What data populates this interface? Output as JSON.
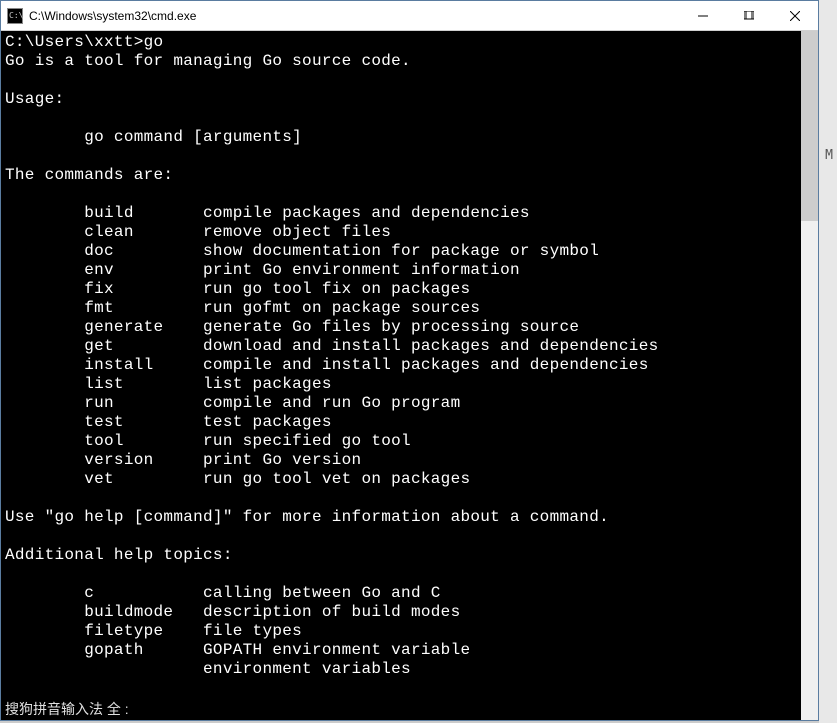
{
  "window": {
    "title": "C:\\Windows\\system32\\cmd.exe",
    "icon_text": "C:\\"
  },
  "prompt": {
    "path": "C:\\Users\\xxtt>",
    "command": "go"
  },
  "output": {
    "intro": "Go is a tool for managing Go source code.",
    "usage_label": "Usage:",
    "usage_line": "        go command [arguments]",
    "commands_header": "The commands are:",
    "commands": [
      {
        "name": "build",
        "desc": "compile packages and dependencies"
      },
      {
        "name": "clean",
        "desc": "remove object files"
      },
      {
        "name": "doc",
        "desc": "show documentation for package or symbol"
      },
      {
        "name": "env",
        "desc": "print Go environment information"
      },
      {
        "name": "fix",
        "desc": "run go tool fix on packages"
      },
      {
        "name": "fmt",
        "desc": "run gofmt on package sources"
      },
      {
        "name": "generate",
        "desc": "generate Go files by processing source"
      },
      {
        "name": "get",
        "desc": "download and install packages and dependencies"
      },
      {
        "name": "install",
        "desc": "compile and install packages and dependencies"
      },
      {
        "name": "list",
        "desc": "list packages"
      },
      {
        "name": "run",
        "desc": "compile and run Go program"
      },
      {
        "name": "test",
        "desc": "test packages"
      },
      {
        "name": "tool",
        "desc": "run specified go tool"
      },
      {
        "name": "version",
        "desc": "print Go version"
      },
      {
        "name": "vet",
        "desc": "run go tool vet on packages"
      }
    ],
    "help_hint": "Use \"go help [command]\" for more information about a command.",
    "topics_header": "Additional help topics:",
    "topics": [
      {
        "name": "c",
        "desc": "calling between Go and C"
      },
      {
        "name": "buildmode",
        "desc": "description of build modes"
      },
      {
        "name": "filetype",
        "desc": "file types"
      },
      {
        "name": "gopath",
        "desc": "GOPATH environment variable"
      }
    ],
    "partial_last": "environment variables"
  },
  "ime": {
    "text": "搜狗拼音输入法 全 :"
  },
  "bg_char": "M"
}
